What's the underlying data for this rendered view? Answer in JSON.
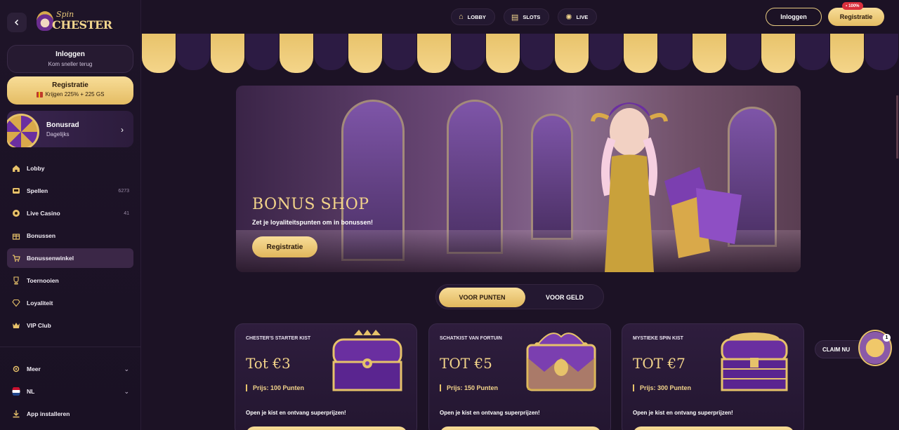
{
  "logo": {
    "top": "Spin",
    "main": "CHESTER"
  },
  "sidebar": {
    "login": {
      "title": "Inloggen",
      "subtitle": "Kom sneller terug"
    },
    "register": {
      "title": "Registratie",
      "subtitle": "Krijgen 225% + 225 GS"
    },
    "bonusrad": {
      "title": "Bonusrad",
      "subtitle": "Dagelijks"
    },
    "items": [
      {
        "label": "Lobby",
        "icon": "home-icon",
        "count": ""
      },
      {
        "label": "Spellen",
        "icon": "slots-icon",
        "count": "6273"
      },
      {
        "label": "Live Casino",
        "icon": "live-icon",
        "count": "41"
      },
      {
        "label": "Bonussen",
        "icon": "gift-icon",
        "count": ""
      },
      {
        "label": "Bonussenwinkel",
        "icon": "cart-icon",
        "count": "",
        "active": true
      },
      {
        "label": "Toernooien",
        "icon": "trophy-icon",
        "count": ""
      },
      {
        "label": "Loyaliteit",
        "icon": "diamond-icon",
        "count": ""
      },
      {
        "label": "VIP Club",
        "icon": "crown-icon",
        "count": ""
      }
    ],
    "bottom": [
      {
        "label": "Meer",
        "icon": "gear-icon"
      },
      {
        "label": "NL",
        "icon": "flag-nl-icon"
      },
      {
        "label": "App installeren",
        "icon": "download-icon"
      }
    ]
  },
  "topnav": [
    {
      "label": "LOBBY",
      "icon": "home-icon"
    },
    {
      "label": "SLOTS",
      "icon": "slots-icon"
    },
    {
      "label": "LIVE",
      "icon": "live-icon"
    }
  ],
  "header": {
    "login": "Inloggen",
    "register": "Registratie",
    "badge": "100%"
  },
  "banner": {
    "title": "BONUS SHOP",
    "subtitle": "Zet je loyaliteitspunten om in bonussen!",
    "button": "Registratie"
  },
  "toggle": {
    "option1": "VOOR PUNTEN",
    "option2": "VOOR GELD"
  },
  "cards": [
    {
      "title": "CHESTER'S STARTER KIST",
      "value": "Tot €3",
      "price": "Prijs: 100 Punten",
      "desc": "Open je kist en ontvang superprijzen!"
    },
    {
      "title": "SCHATKIST VAN FORTUIN",
      "value": "TOT €5",
      "price": "Prijs: 150 Punten",
      "desc": "Open je kist en ontvang superprijzen!"
    },
    {
      "title": "MYSTIEKE SPIN KIST",
      "value": "TOT €7",
      "price": "Prijs: 300 Punten",
      "desc": "Open je kist en ontvang superprijzen!"
    }
  ],
  "claim": {
    "label": "CLAIM NU",
    "count": "1"
  },
  "colors": {
    "gold": "#e6c26a",
    "purple": "#2c1b43",
    "bg": "#1c1225"
  }
}
